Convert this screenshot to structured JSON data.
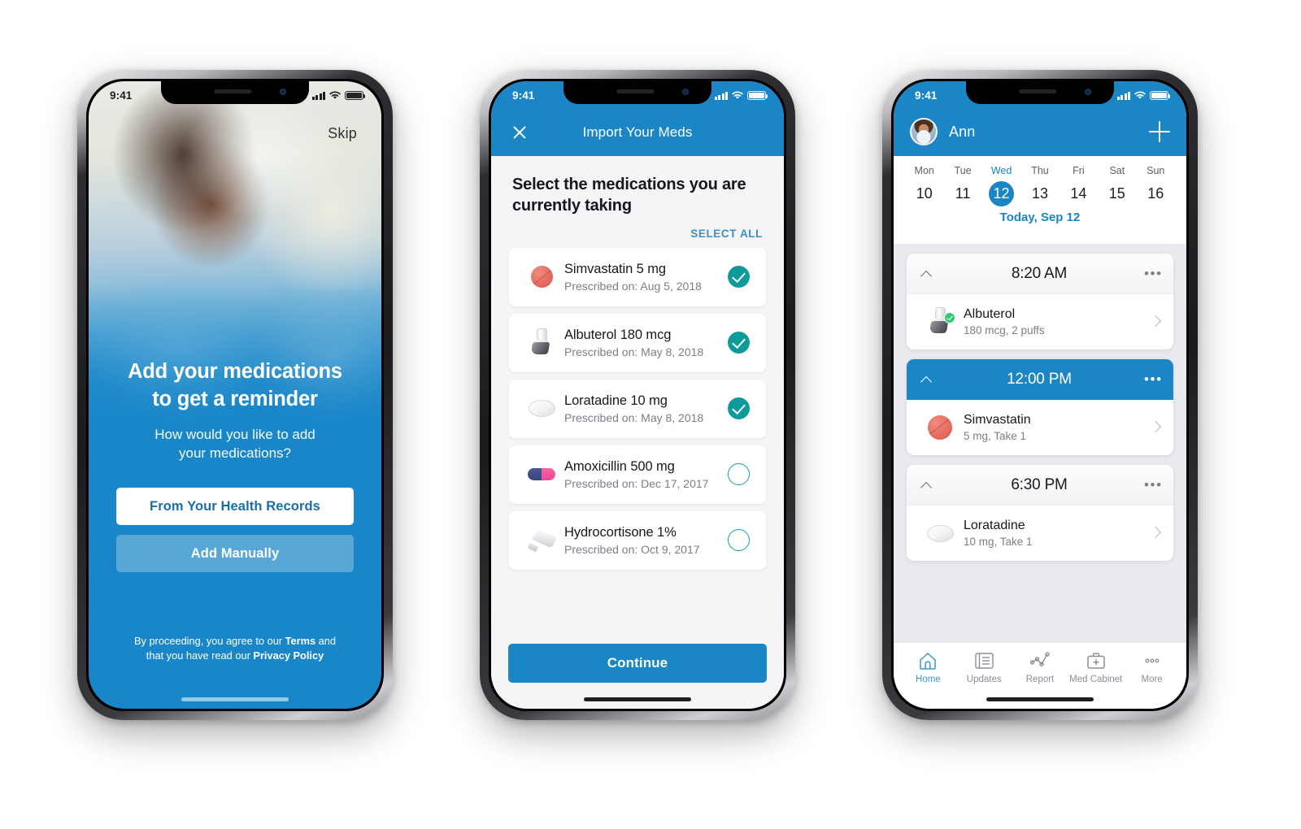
{
  "screens": {
    "onboarding": {
      "status": {
        "time": "9:41"
      },
      "skip_label": "Skip",
      "title_line1": "Add your medications",
      "title_line2": "to get a reminder",
      "subtitle_line1": "How would you like to add",
      "subtitle_line2": "your medications?",
      "primary_button": "From Your Health Records",
      "secondary_button": "Add Manually",
      "legal": {
        "part1": "By proceeding, you agree to our ",
        "terms": "Terms",
        "part2": " and",
        "part3": "that you have read our ",
        "privacy": "Privacy Policy"
      }
    },
    "import": {
      "status": {
        "time": "9:41"
      },
      "nav_title": "Import Your Meds",
      "close_icon": "close-icon",
      "heading": "Select the medications you are currently taking",
      "select_all_label": "SELECT ALL",
      "continue_label": "Continue",
      "medications": [
        {
          "name": "Simvastatin 5 mg",
          "prescribed": "Prescribed on: Aug 5, 2018",
          "icon": "pill-round-red",
          "selected": true
        },
        {
          "name": "Albuterol 180 mcg",
          "prescribed": "Prescribed on: May 8, 2018",
          "icon": "inhaler",
          "selected": true
        },
        {
          "name": "Loratadine 10 mg",
          "prescribed": "Prescribed on: May 8, 2018",
          "icon": "pill-oval-white",
          "selected": true
        },
        {
          "name": "Amoxicillin 500 mg",
          "prescribed": "Prescribed on: Dec 17, 2017",
          "icon": "capsule-pink",
          "selected": false
        },
        {
          "name": "Hydrocortisone 1%",
          "prescribed": "Prescribed on: Oct 9, 2017",
          "icon": "ointment-tube",
          "selected": false
        }
      ]
    },
    "home": {
      "status": {
        "time": "9:41"
      },
      "user_name": "Ann",
      "add_icon": "plus-icon",
      "avatar_icon": "avatar",
      "week": [
        {
          "dow": "Mon",
          "num": "10",
          "active": false
        },
        {
          "dow": "Tue",
          "num": "11",
          "active": false
        },
        {
          "dow": "Wed",
          "num": "12",
          "active": true
        },
        {
          "dow": "Thu",
          "num": "13",
          "active": false
        },
        {
          "dow": "Fri",
          "num": "14",
          "active": false
        },
        {
          "dow": "Sat",
          "num": "15",
          "active": false
        },
        {
          "dow": "Sun",
          "num": "16",
          "active": false
        }
      ],
      "today_label": "Today, Sep 12",
      "schedule": [
        {
          "time": "8:20 AM",
          "highlighted": false,
          "overflow": "•••",
          "med_name": "Albuterol",
          "med_dose": "180 mcg, 2 puffs",
          "icon": "inhaler",
          "taken": true
        },
        {
          "time": "12:00 PM",
          "highlighted": true,
          "overflow": "•••",
          "med_name": "Simvastatin",
          "med_dose": "5 mg, Take 1",
          "icon": "pill-round-red",
          "taken": false
        },
        {
          "time": "6:30 PM",
          "highlighted": false,
          "overflow": "•••",
          "med_name": "Loratadine",
          "med_dose": "10 mg, Take 1",
          "icon": "pill-oval-white",
          "taken": false
        }
      ],
      "tabs": [
        {
          "label": "Home",
          "icon": "home-icon",
          "active": true
        },
        {
          "label": "Updates",
          "icon": "news-icon",
          "active": false
        },
        {
          "label": "Report",
          "icon": "chart-icon",
          "active": false
        },
        {
          "label": "Med Cabinet",
          "icon": "medkit-icon",
          "active": false
        },
        {
          "label": "More",
          "icon": "ellipsis-icon",
          "active": false
        }
      ]
    }
  },
  "colors": {
    "brand_blue": "#1A86C6",
    "hero_blue": "#1886C8",
    "teal_check": "#0F9A9A",
    "green_taken": "#2ECC71",
    "pill_red": "#E4665A",
    "capsule_navy": "#3D4A8C",
    "capsule_pink": "#EE4A94",
    "list_bg": "#F5F5F7",
    "home_bg": "#E9E9EF"
  }
}
